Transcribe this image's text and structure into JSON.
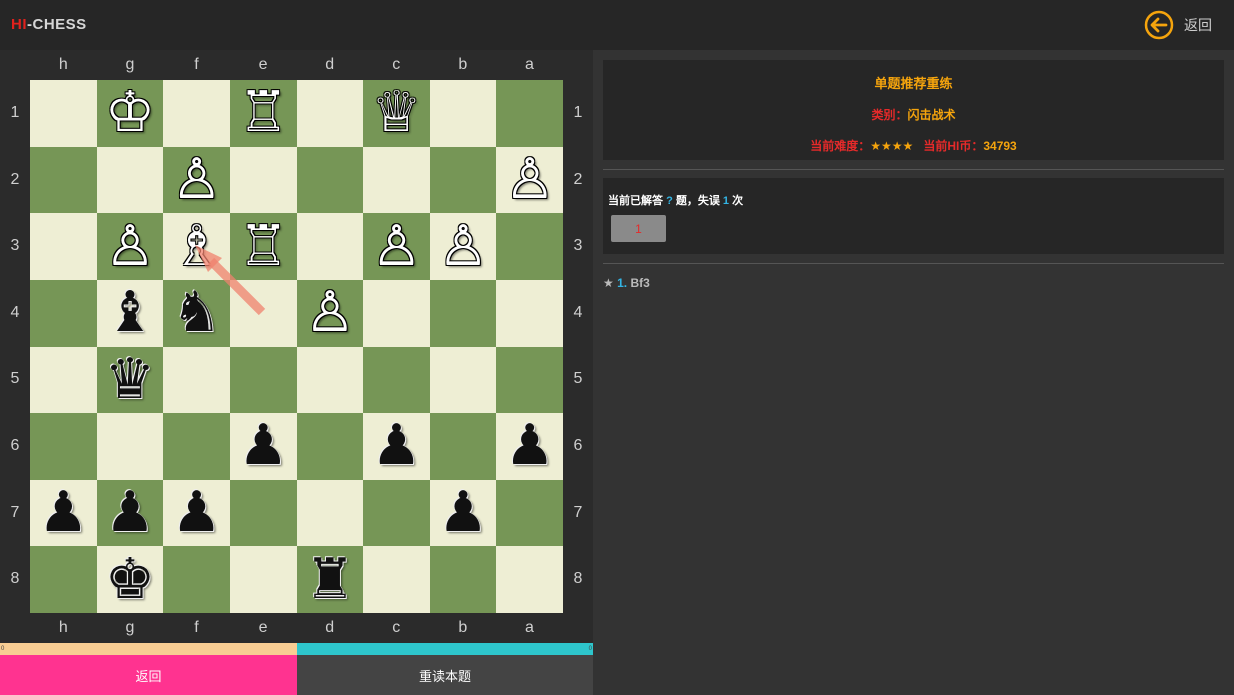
{
  "app": {
    "logo_hi": "HI",
    "logo_rest": "-CHESS"
  },
  "header": {
    "back_label": "返回"
  },
  "board": {
    "files": [
      "h",
      "g",
      "f",
      "e",
      "d",
      "c",
      "b",
      "a"
    ],
    "ranks": [
      "1",
      "2",
      "3",
      "4",
      "5",
      "6",
      "7",
      "8"
    ],
    "pieces": [
      {
        "row": 0,
        "col": 1,
        "glyph": "♔",
        "color": "white",
        "name": "white-king"
      },
      {
        "row": 0,
        "col": 3,
        "glyph": "♖",
        "color": "white",
        "name": "white-rook"
      },
      {
        "row": 0,
        "col": 5,
        "glyph": "♕",
        "color": "white",
        "name": "white-queen"
      },
      {
        "row": 1,
        "col": 2,
        "glyph": "♙",
        "color": "white",
        "name": "white-pawn"
      },
      {
        "row": 1,
        "col": 7,
        "glyph": "♙",
        "color": "white",
        "name": "white-pawn"
      },
      {
        "row": 2,
        "col": 1,
        "glyph": "♙",
        "color": "white",
        "name": "white-pawn"
      },
      {
        "row": 2,
        "col": 2,
        "glyph": "♗",
        "color": "white",
        "name": "white-bishop"
      },
      {
        "row": 2,
        "col": 3,
        "glyph": "♖",
        "color": "white",
        "name": "white-rook"
      },
      {
        "row": 2,
        "col": 5,
        "glyph": "♙",
        "color": "white",
        "name": "white-pawn"
      },
      {
        "row": 2,
        "col": 6,
        "glyph": "♙",
        "color": "white",
        "name": "white-pawn"
      },
      {
        "row": 3,
        "col": 1,
        "glyph": "♝",
        "color": "black",
        "name": "black-bishop"
      },
      {
        "row": 3,
        "col": 2,
        "glyph": "♞",
        "color": "black",
        "name": "black-knight"
      },
      {
        "row": 3,
        "col": 4,
        "glyph": "♙",
        "color": "white",
        "name": "white-pawn"
      },
      {
        "row": 4,
        "col": 1,
        "glyph": "♛",
        "color": "black",
        "name": "black-queen"
      },
      {
        "row": 5,
        "col": 3,
        "glyph": "♟",
        "color": "black",
        "name": "black-pawn"
      },
      {
        "row": 5,
        "col": 5,
        "glyph": "♟",
        "color": "black",
        "name": "black-pawn"
      },
      {
        "row": 5,
        "col": 7,
        "glyph": "♟",
        "color": "black",
        "name": "black-pawn"
      },
      {
        "row": 6,
        "col": 0,
        "glyph": "♟",
        "color": "black",
        "name": "black-pawn"
      },
      {
        "row": 6,
        "col": 1,
        "glyph": "♟",
        "color": "black",
        "name": "black-pawn"
      },
      {
        "row": 6,
        "col": 2,
        "glyph": "♟",
        "color": "black",
        "name": "black-pawn"
      },
      {
        "row": 6,
        "col": 6,
        "glyph": "♟",
        "color": "black",
        "name": "black-pawn"
      },
      {
        "row": 7,
        "col": 1,
        "glyph": "♚",
        "color": "black",
        "name": "black-king"
      },
      {
        "row": 7,
        "col": 4,
        "glyph": "♜",
        "color": "black",
        "name": "black-rook"
      }
    ],
    "arrow_color": "#f0826e"
  },
  "progress": {
    "left_value": "0",
    "right_value": "0",
    "left_color": "#f8cd93",
    "right_color": "#2ec6cc"
  },
  "buttons": {
    "back_label": "返回",
    "redo_label": "重读本题"
  },
  "puzzle": {
    "title": "单题推荐重练",
    "category_label": "类别：",
    "category_value": "闪击战术",
    "difficulty_label": "当前难度：",
    "difficulty_value": "★★★★",
    "coins_label": "当前HI币：",
    "coins_value": "34793"
  },
  "status": {
    "prefix": "当前已解答",
    "solved": "?",
    "mid": "题，失误",
    "errors": "1",
    "suffix": "次",
    "attempt_label": "1"
  },
  "moves": {
    "star": "★",
    "number": "1.",
    "move": "Bf3"
  }
}
